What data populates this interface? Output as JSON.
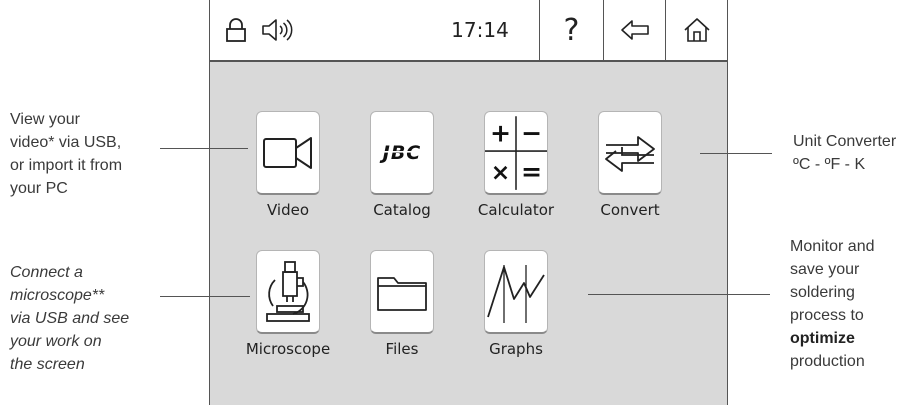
{
  "topbar": {
    "time": "17:14",
    "help_label": "?"
  },
  "apps": {
    "video": "Video",
    "catalog": "Catalog",
    "calculator": "Calculator",
    "convert": "Convert",
    "microscope": "Microscope",
    "files": "Files",
    "graphs": "Graphs"
  },
  "logo": {
    "jbc": "JBC"
  },
  "calc_keys": {
    "plus": "+",
    "minus": "−",
    "times": "×",
    "equals": "="
  },
  "annotations": {
    "video": [
      "View your",
      "video* via USB,",
      "or import it from",
      "your PC"
    ],
    "microscope": [
      "Connect a",
      "microscope**",
      "via USB and see",
      "your work on",
      "the screen"
    ],
    "converter": [
      "Unit Converter",
      "ºC - ºF - K"
    ],
    "graphs": [
      "Monitor and",
      "save your",
      "soldering",
      "process to"
    ],
    "graphs_bold": "optimize",
    "graphs_last": "production"
  },
  "colors": {
    "screen_bg": "#d9d9d9",
    "tile_bg": "#ffffff",
    "border": "#555555"
  }
}
